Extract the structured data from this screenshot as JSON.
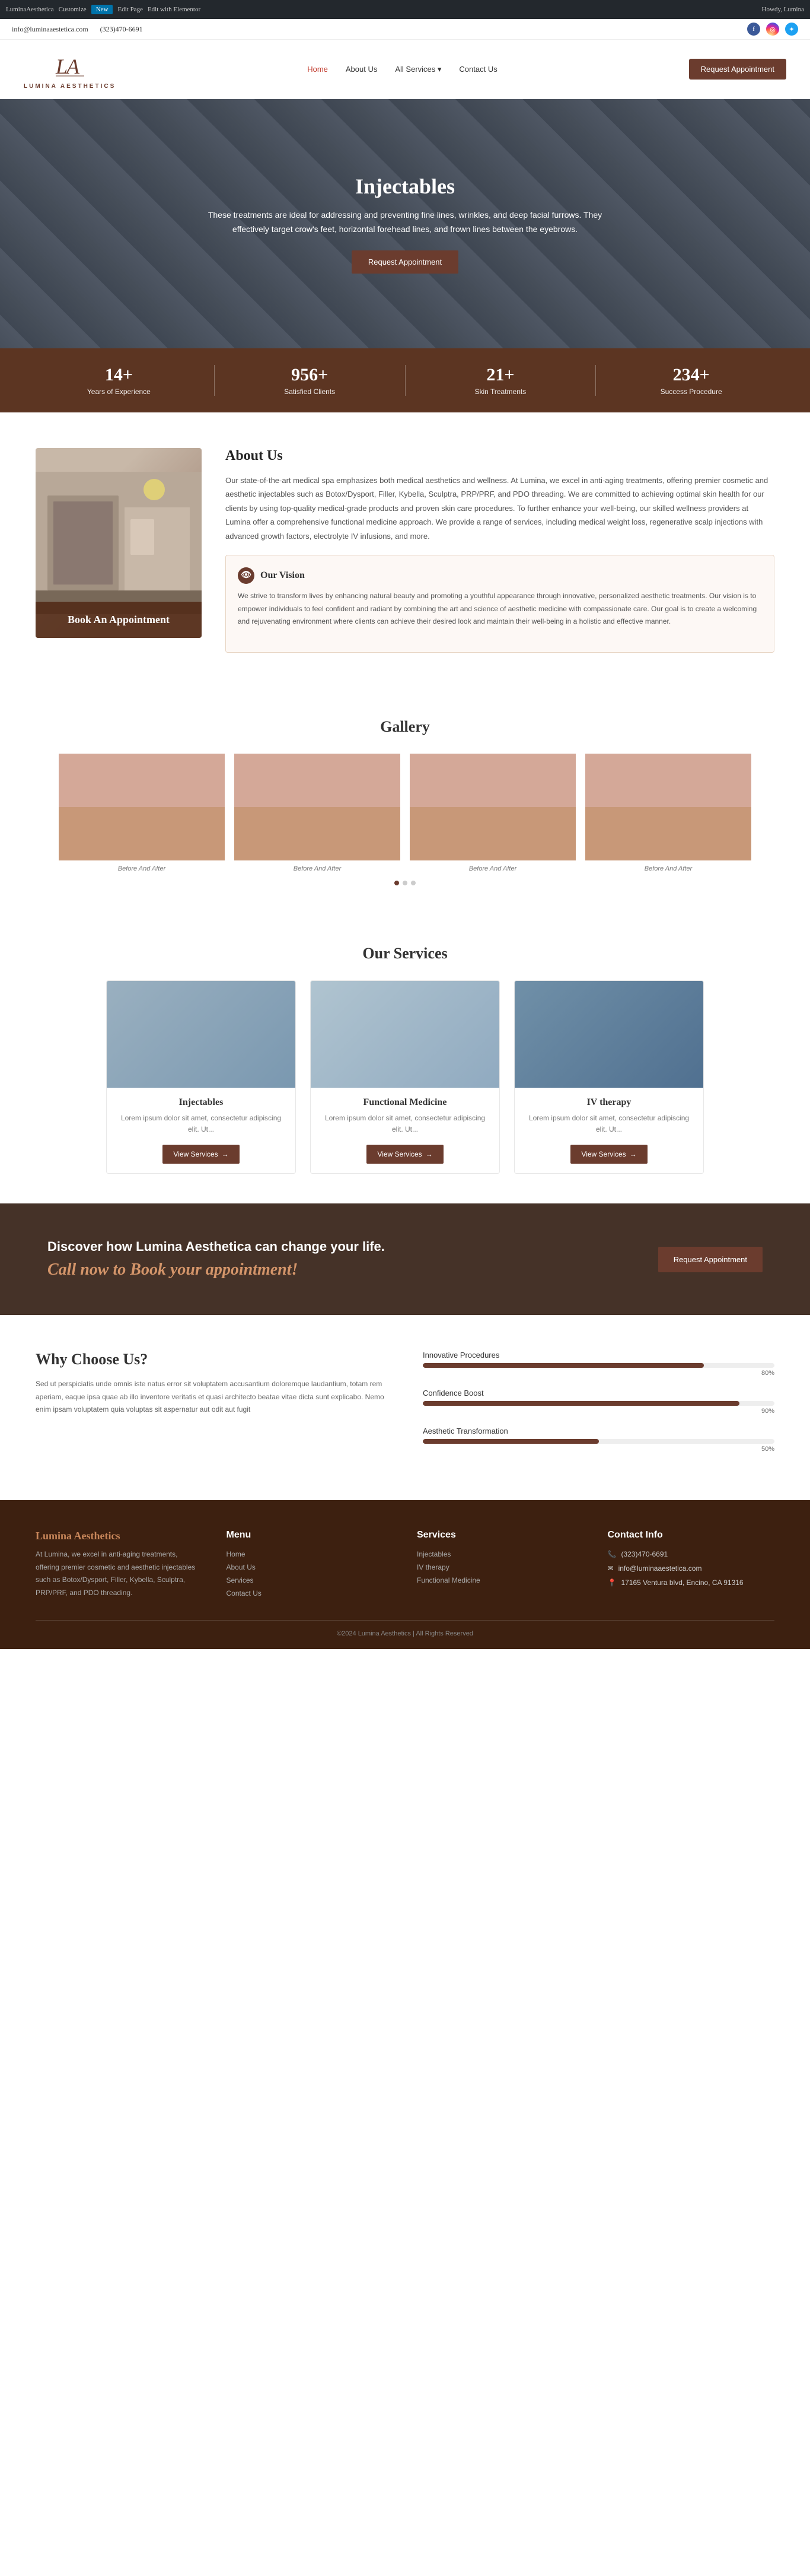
{
  "adminBar": {
    "siteName": "LuminaAesthetica",
    "customize": "Customize",
    "newLabel": "New",
    "editPage": "Edit Page",
    "editWithElementor": "Edit with Elementor",
    "howdy": "Howdy, Lumina"
  },
  "infoBar": {
    "email": "info@luminaaestetica.com",
    "phone": "(323)470-6691",
    "social": [
      "f",
      "◎",
      "✦"
    ]
  },
  "header": {
    "logoMonogram": "LA",
    "logoSub": "LUMINA AESTHETICS",
    "nav": [
      "Home",
      "About Us",
      "All Services",
      "Contact Us"
    ],
    "cta": "Request Appointment"
  },
  "hero": {
    "title": "Injectables",
    "description": "These treatments are ideal for addressing and preventing fine lines, wrinkles, and deep facial furrows. They effectively target crow's feet, horizontal forehead lines, and frown lines between the eyebrows.",
    "buttonLabel": "Request Appointment"
  },
  "stats": [
    {
      "number": "14+",
      "label": "Years of Experience"
    },
    {
      "number": "956+",
      "label": "Satisfied Clients"
    },
    {
      "number": "21+",
      "label": "Skin Treatments"
    },
    {
      "number": "234+",
      "label": "Success Procedure"
    }
  ],
  "about": {
    "title": "About Us",
    "description": "Our state-of-the-art medical spa emphasizes both medical aesthetics and wellness. At Lumina, we excel in anti-aging treatments, offering premier cosmetic and aesthetic injectables such as Botox/Dysport, Filler, Kybella, Sculptra, PRP/PRF, and PDO threading. We are committed to achieving optimal skin health for our clients by using top-quality medical-grade products and proven skin care procedures. To further enhance your well-being, our skilled wellness providers at Lumina offer a comprehensive functional medicine approach. We provide a range of services, including medical weight loss, regenerative scalp injections with advanced growth factors, electrolyte IV infusions, and more.",
    "bookAppt": "Book An Appointment",
    "vision": {
      "title": "Our Vision",
      "description": "We strive to transform lives by enhancing natural beauty and promoting a youthful appearance through innovative, personalized aesthetic treatments. Our vision is to empower individuals to feel confident and radiant by combining the art and science of aesthetic medicine with compassionate care. Our goal is to create a welcoming and rejuvenating environment where clients can achieve their desired look and maintain their well-being in a holistic and effective manner."
    }
  },
  "gallery": {
    "title": "Gallery",
    "items": [
      {
        "label": "Before And After"
      },
      {
        "label": "Before And After"
      },
      {
        "label": "Before And After"
      },
      {
        "label": "Before And After"
      }
    ],
    "dots": 3,
    "activeDot": 0
  },
  "services": {
    "title": "Our Services",
    "items": [
      {
        "title": "Injectables",
        "description": "Lorem ipsum dolor sit amet, consectetur adipiscing elit. Ut...",
        "btnLabel": "View Services"
      },
      {
        "title": "Functional Medicine",
        "description": "Lorem ipsum dolor sit amet, consectetur adipiscing elit. Ut...",
        "btnLabel": "View Services"
      },
      {
        "title": "IV therapy",
        "description": "Lorem ipsum dolor sit amet, consectetur adipiscing elit. Ut...",
        "btnLabel": "View Services"
      }
    ]
  },
  "ctaBanner": {
    "line1": "Discover how Lumina Aesthetica can change your life.",
    "line2": "Call now to Book your appointment!",
    "btnLabel": "Request Appointment"
  },
  "whyChoose": {
    "title": "Why Choose Us?",
    "description": "Sed ut perspiciatis unde omnis iste natus error sit voluptatem accusantium doloremque laudantium, totam rem aperiam, eaque ipsa quae ab illo inventore veritatis et quasi architecto beatae vitae dicta sunt explicabo. Nemo enim ipsam voluptatem quia voluptas sit aspernatur aut odit aut fugit",
    "progressItems": [
      {
        "label": "Innovative Procedures",
        "percent": 80
      },
      {
        "label": "Confidence Boost",
        "percent": 90
      },
      {
        "label": "Aesthetic Transformation",
        "percent": 50
      }
    ]
  },
  "footer": {
    "brandName": "Lumina Aesthetics",
    "brandDesc": "At Lumina, we excel in anti-aging treatments, offering premier cosmetic and aesthetic injectables such as Botox/Dysport, Filler, Kybella, Sculptra, PRP/PRF, and PDO threading.",
    "menuTitle": "Menu",
    "menuItems": [
      "Home",
      "About Us",
      "Services",
      "Contact Us"
    ],
    "servicesTitle": "Services",
    "serviceItems": [
      "Injectables",
      "IV therapy",
      "Functional Medicine"
    ],
    "contactTitle": "Contact Info",
    "phone": "(323)470-6691",
    "email": "info@luminaaestetica.com",
    "address": "17165 Ventura blvd, Encino, CA 91316",
    "copyright": "©2024 Lumina Aesthetics | All Rights Reserved"
  }
}
